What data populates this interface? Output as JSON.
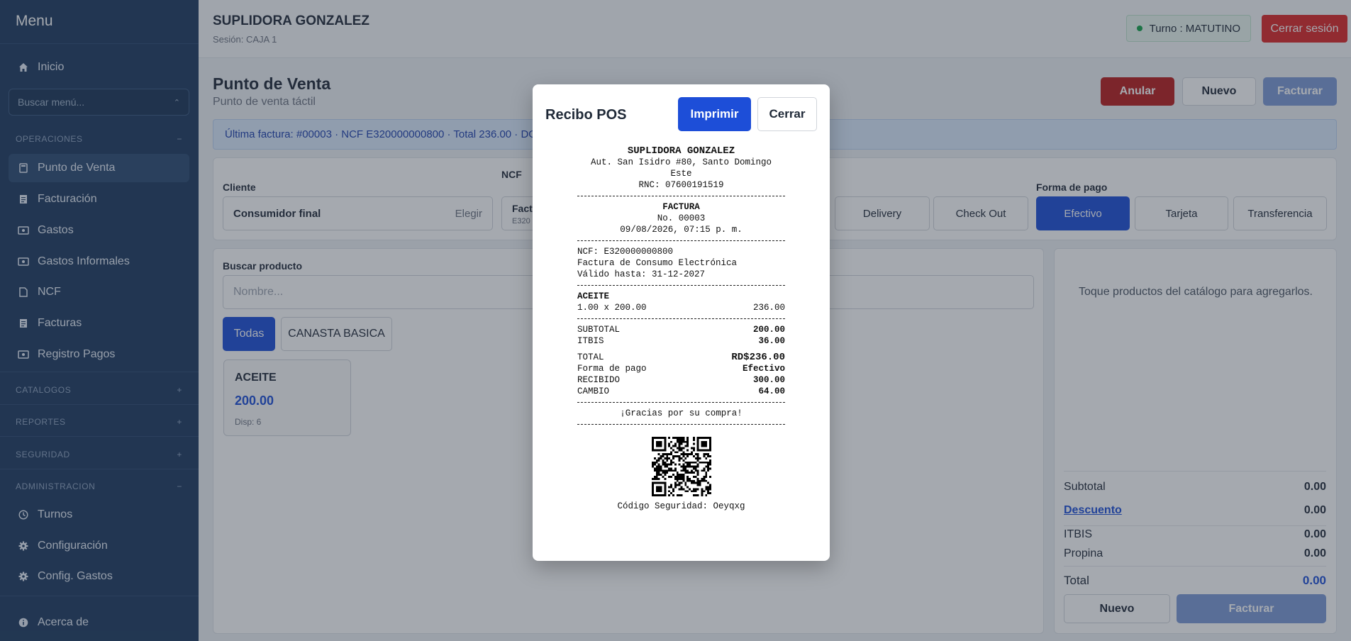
{
  "sidebar": {
    "title": "Menu",
    "search_placeholder": "Buscar menú...",
    "items_top": [
      {
        "label": "Inicio",
        "icon": "home-icon"
      }
    ],
    "sections": [
      {
        "label": "OPERACIONES",
        "toggle": "−"
      },
      {
        "label": "CATALOGOS",
        "toggle": "+"
      },
      {
        "label": "REPORTES",
        "toggle": "+"
      },
      {
        "label": "SEGURIDAD",
        "toggle": "+"
      },
      {
        "label": "ADMINISTRACION",
        "toggle": "−"
      }
    ],
    "operaciones": [
      {
        "label": "Punto de Venta",
        "icon": "pos-icon",
        "active": true
      },
      {
        "label": "Facturación",
        "icon": "invoice-icon"
      },
      {
        "label": "Gastos",
        "icon": "money-icon"
      },
      {
        "label": "Gastos Informales",
        "icon": "money-icon"
      },
      {
        "label": "NCF",
        "icon": "document-icon"
      },
      {
        "label": "Facturas",
        "icon": "invoice-icon"
      },
      {
        "label": "Registro Pagos",
        "icon": "money-icon"
      }
    ],
    "administracion": [
      {
        "label": "Turnos",
        "icon": "clock-icon"
      },
      {
        "label": "Configuración",
        "icon": "gear-icon"
      },
      {
        "label": "Config. Gastos",
        "icon": "gear-icon"
      }
    ],
    "footer": {
      "label": "Acerca de",
      "icon": "info-icon"
    }
  },
  "header": {
    "company": "SUPLIDORA GONZALEZ",
    "session": "Sesión: CAJA 1",
    "turno": "Turno : MATUTINO",
    "logout": "Cerrar sesión"
  },
  "page": {
    "title": "Punto de Venta",
    "subtitle": "Punto de venta táctil",
    "actions": {
      "anular": "Anular",
      "nuevo": "Nuevo",
      "facturar": "Facturar"
    },
    "banner": "Última factura: #00003 · NCF E320000000800 · Total 236.00 · DGII"
  },
  "order": {
    "client_label": "Cliente",
    "client_value": "Consumidor final",
    "client_choose": "Elegir",
    "ncf_label": "NCF",
    "ncf_value_line1": "Fact",
    "ncf_value_line2": "E320",
    "service_options": [
      "Delivery",
      "Check Out"
    ],
    "payment_label": "Forma de pago",
    "payment_options": [
      "Efectivo",
      "Tarjeta",
      "Transferencia"
    ],
    "payment_selected": "Efectivo"
  },
  "catalog": {
    "search_label": "Buscar producto",
    "search_placeholder": "Nombre...",
    "categories": [
      "Todas",
      "CANASTA BASICA"
    ],
    "products": [
      {
        "name": "ACEITE",
        "price": "200.00",
        "stock": "Disp: 6"
      }
    ]
  },
  "cart": {
    "empty_text": "Toque productos del catálogo para agregarlos.",
    "subtotal_label": "Subtotal",
    "subtotal": "0.00",
    "descuento_label": "Descuento",
    "descuento": "0.00",
    "itbis_label": "ITBIS",
    "itbis": "0.00",
    "propina_label": "Propina",
    "propina": "0.00",
    "total_label": "Total",
    "total": "0.00",
    "nuevo": "Nuevo",
    "facturar": "Facturar"
  },
  "modal": {
    "title": "Recibo POS",
    "print": "Imprimir",
    "close": "Cerrar",
    "receipt": {
      "company": "SUPLIDORA GONZALEZ",
      "address1": "Aut. San Isidro #80, Santo Domingo",
      "address2": "Este",
      "rnc": "RNC: 07600191519",
      "doc_type": "FACTURA",
      "number": "No. 00003",
      "datetime": "09/08/2026, 07:15 p. m.",
      "ncf": "NCF: E320000000800",
      "ncf_type": "Factura de Consumo Electrónica",
      "valid": "Válido hasta: 31-12-2027",
      "item_name": "ACEITE",
      "item_qty": "1.00 x 200.00",
      "item_total": "236.00",
      "subtotal_label": "SUBTOTAL",
      "subtotal": "200.00",
      "itbis_label": "ITBIS",
      "itbis": "36.00",
      "total_label": "TOTAL",
      "total": "RD$236.00",
      "payment_label": "Forma de pago",
      "payment": "Efectivo",
      "received_label": "RECIBIDO",
      "received": "300.00",
      "change_label": "CAMBIO",
      "change": "64.00",
      "thanks": "¡Gracias por su compra!",
      "security": "Código Seguridad: Oeyqxg"
    }
  }
}
